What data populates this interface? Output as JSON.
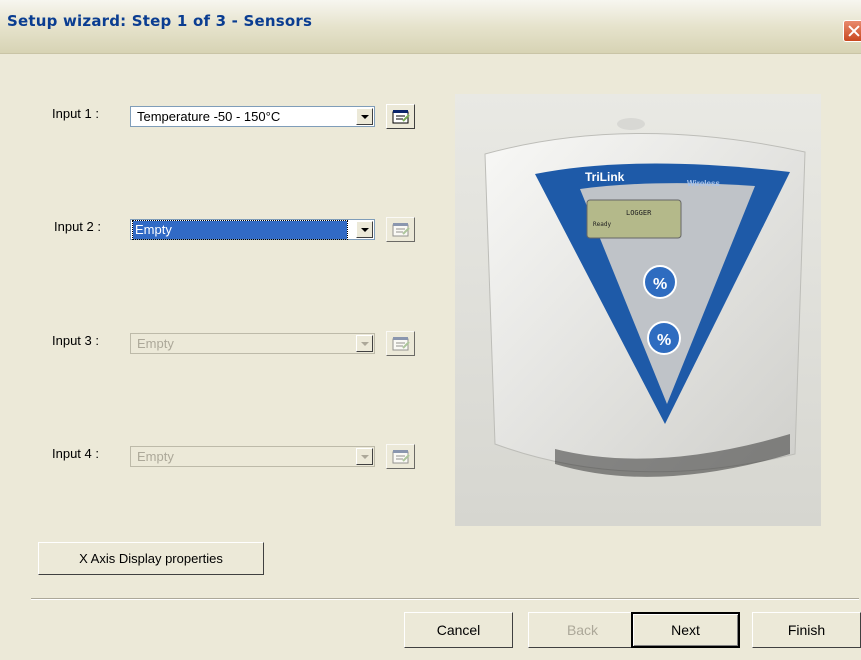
{
  "window": {
    "title": "Setup wizard: Step 1 of 3 - Sensors"
  },
  "inputs": [
    {
      "label": "Input 1 :",
      "value": "Temperature -50 - 150°C"
    },
    {
      "label": "Input 2 :",
      "value": "Empty"
    },
    {
      "label": "Input 3 :",
      "value": "Empty"
    },
    {
      "label": "Input 4 :",
      "value": "Empty"
    }
  ],
  "device": {
    "brand": "TriLink",
    "wireless_label": "Wireless",
    "display_line1": "LOGGER",
    "display_line2": "Ready"
  },
  "x_axis_button": "X Axis Display properties",
  "buttons": {
    "cancel": "Cancel",
    "back": "Back",
    "next": "Next",
    "finish": "Finish"
  },
  "colors": {
    "title_text": "#0A3D91",
    "selection": "#316AC5",
    "device_accent": "#1E5AA8",
    "close_button": "#C9481F"
  }
}
